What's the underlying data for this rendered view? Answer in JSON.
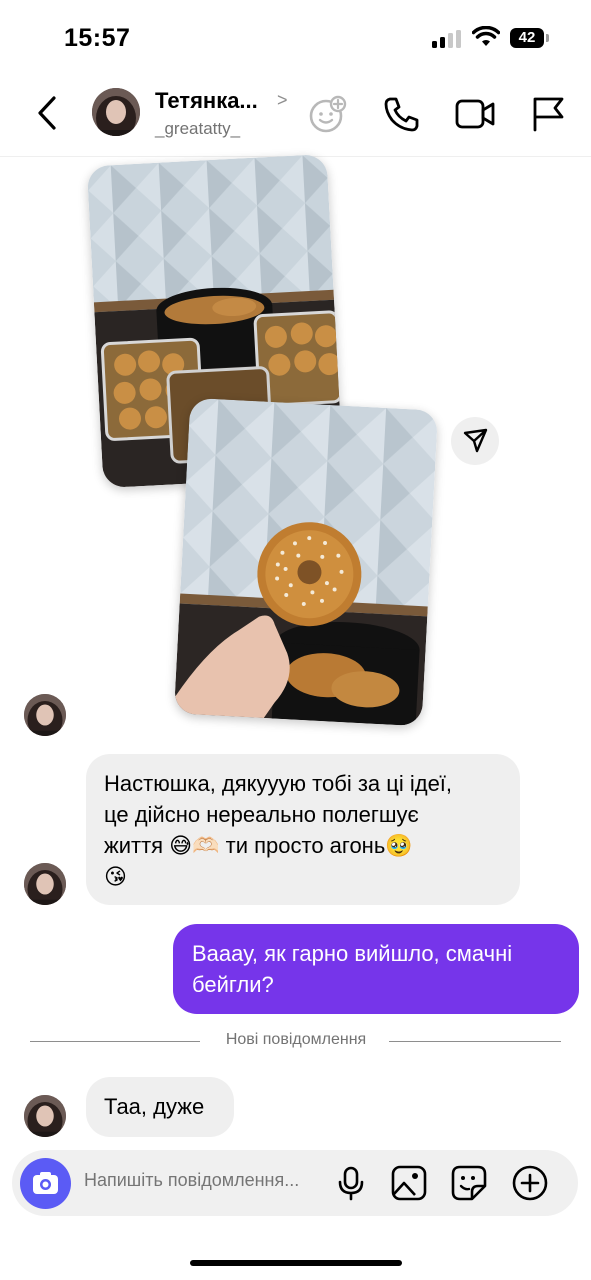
{
  "status_bar": {
    "time": "15:57",
    "battery": "42"
  },
  "header": {
    "name": "Тетянка...",
    "chevron": ">",
    "username": "_greatatty_",
    "icons": [
      "back-icon",
      "effects-icon",
      "phone-icon",
      "video-icon",
      "flag-icon"
    ]
  },
  "messages": {
    "received_1": {
      "lines": [
        "Настюшка, дякууую тобі за ці ідеї,",
        "це дійсно нереально полегшує",
        "життя 😅🫶🏻 ти просто агонь🥹",
        "😘"
      ]
    },
    "sent_1": {
      "lines": [
        "Вааау, як гарно вийшло, смачні",
        "бейгли?"
      ]
    },
    "new_messages_divider": "Нові повідомлення",
    "received_2": {
      "text": "Таа, дуже"
    }
  },
  "composer": {
    "placeholder": "Напишіть повідомлення...",
    "icons": [
      "camera-icon",
      "microphone-icon",
      "gallery-icon",
      "sticker-icon",
      "plus-icon"
    ]
  },
  "colors": {
    "sent_bubble": "#7635ea",
    "received_bubble": "#efefef",
    "camera_button": "#5b5bf5"
  }
}
